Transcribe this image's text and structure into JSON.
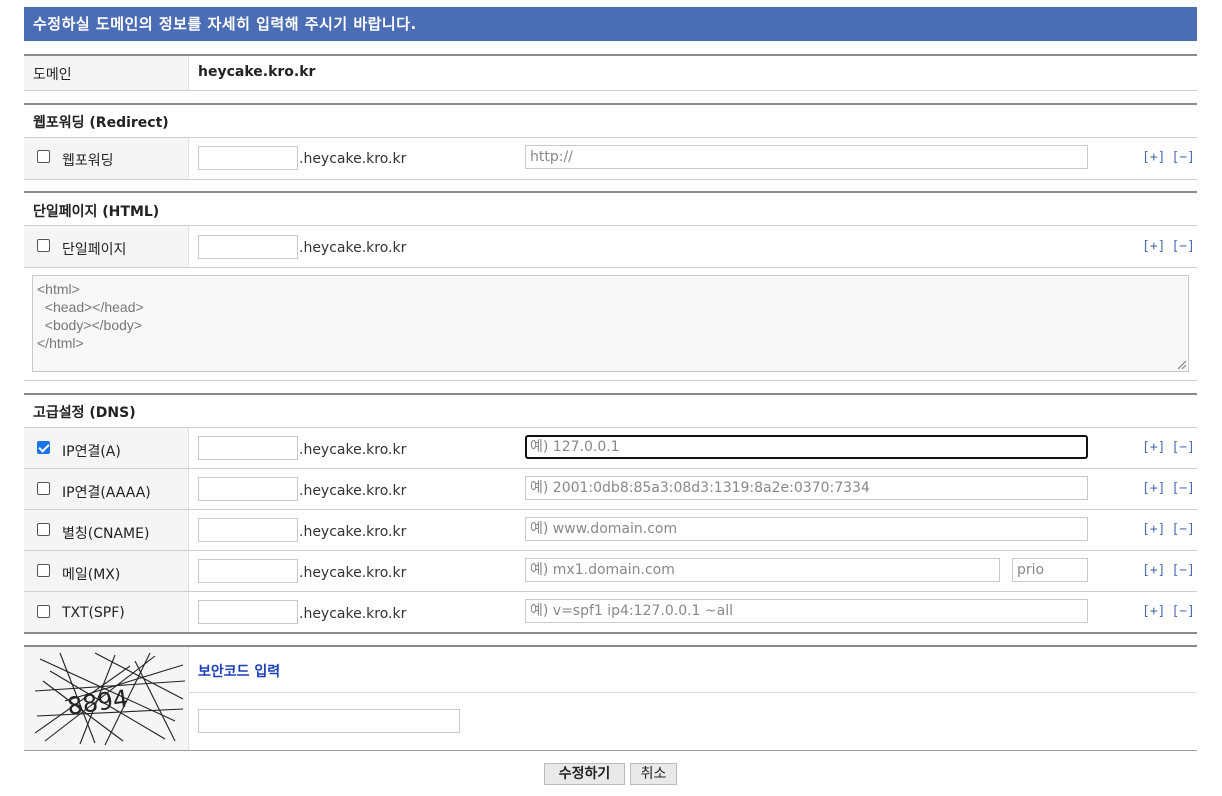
{
  "banner": "수정하실 도메인의 정보를 자세히 입력해 주시기 바랍니다.",
  "domain": {
    "label": "도메인",
    "value": "heycake.kro.kr"
  },
  "suffix": ".heycake.kro.kr",
  "plus": "[+]",
  "minus": "[−]",
  "redirect": {
    "title": "웹포워딩 (Redirect)",
    "row": {
      "label": "웹포워딩",
      "checked": false,
      "placeholder": "http://"
    }
  },
  "single_page": {
    "title": "단일페이지 (HTML)",
    "row": {
      "label": "단일페이지",
      "checked": false
    },
    "html": "<html>\n  <head></head>\n  <body></body>\n</html>"
  },
  "dns": {
    "title": "고급설정 (DNS)",
    "rows": [
      {
        "label": "IP연결(A)",
        "checked": true,
        "placeholder": "예) 127.0.0.1"
      },
      {
        "label": "IP연결(AAAA)",
        "checked": false,
        "placeholder": "예) 2001:0db8:85a3:08d3:1319:8a2e:0370:7334"
      },
      {
        "label": "별칭(CNAME)",
        "checked": false,
        "placeholder": "예) www.domain.com"
      },
      {
        "label": "메일(MX)",
        "checked": false,
        "placeholder": "예) mx1.domain.com",
        "prio_placeholder": "prio"
      },
      {
        "label": "TXT(SPF)",
        "checked": false,
        "placeholder": "예) v=spf1 ip4:127.0.0.1 ~all"
      }
    ]
  },
  "captcha": {
    "code_image_text": "8894",
    "label": "보안코드 입력"
  },
  "buttons": {
    "submit": "수정하기",
    "cancel": "취소"
  }
}
